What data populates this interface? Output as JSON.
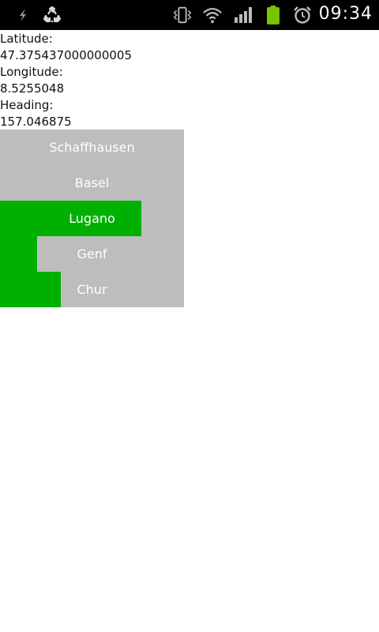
{
  "status_bar": {
    "time": "09:34",
    "icons": [
      "usb-debug-icon",
      "recycle-icon",
      "vibrate-icon",
      "wifi-icon",
      "signal-icon",
      "battery-icon",
      "alarm-icon"
    ],
    "battery_color": "#77c400"
  },
  "location": {
    "latitude_label": "Latitude:",
    "latitude_value": "47.375437000000005",
    "longitude_label": "Longitude:",
    "longitude_value": "8.5255048",
    "heading_label": "Heading:",
    "heading_value": "157.046875"
  },
  "cities": [
    {
      "label": "Schaffhausen",
      "highlight_fraction": 0.0
    },
    {
      "label": "Basel",
      "highlight_fraction": 0.0
    },
    {
      "label": "Lugano",
      "highlight_fraction": 0.77
    },
    {
      "label": "Genf",
      "highlight_fraction": 0.2
    },
    {
      "label": "Chur",
      "highlight_fraction": 0.33
    }
  ],
  "colors": {
    "panel": "#bdbdbd",
    "highlight": "#00b000",
    "status_bar": "#000000"
  }
}
